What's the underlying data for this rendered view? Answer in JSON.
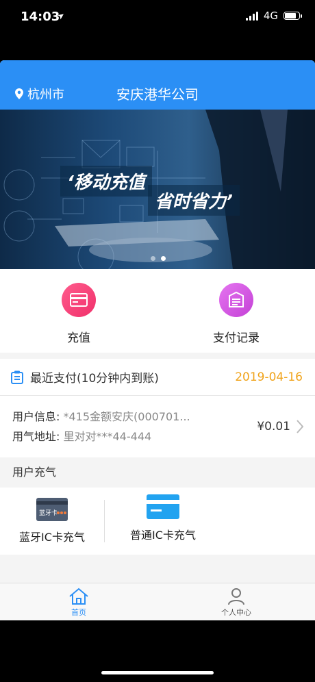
{
  "status_bar": {
    "time": "14:03",
    "network": "4G"
  },
  "header": {
    "city": "杭州市",
    "title": "安庆港华公司"
  },
  "banner": {
    "slogan_1": "‘移动充值",
    "slogan_2": "省时省力’"
  },
  "actions": [
    {
      "label": "充值",
      "icon": "card-icon",
      "color": "#f0306a"
    },
    {
      "label": "支付记录",
      "icon": "receipt-icon",
      "color": "#c441d6"
    }
  ],
  "recent_payment": {
    "title": "最近支付(10分钟内到账)",
    "date": "2019-04-16",
    "user_info_label": "用户信息:",
    "user_info_value": "*415金额安庆(000701...",
    "address_label": "用气地址:",
    "address_value": "里对对***44-444",
    "amount": "¥0.01"
  },
  "section": {
    "title": "用户充气"
  },
  "cards": {
    "bluetooth_label": "蓝牙IC卡充气",
    "bluetooth_card_text": "蓝牙卡",
    "normal_label": "普通IC卡充气"
  },
  "bottom_nav": {
    "home": "首页",
    "profile": "个人中心"
  },
  "colors": {
    "primary": "#2b8ff5",
    "date": "#f0a31a"
  }
}
